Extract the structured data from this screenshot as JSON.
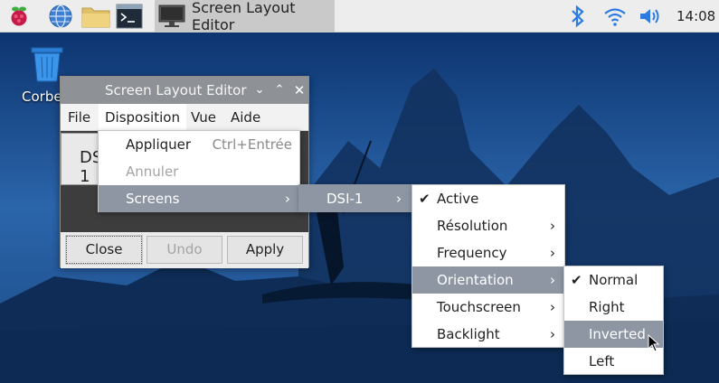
{
  "taskbar": {
    "icons": [
      "raspberry-menu-icon",
      "web-browser-icon",
      "file-manager-icon",
      "terminal-icon"
    ],
    "task_label": "Screen Layout Editor",
    "tray_icons": [
      "bluetooth-icon",
      "wifi-icon",
      "volume-icon"
    ],
    "clock": "14:08"
  },
  "desktop": {
    "trash_label": "Corbeille"
  },
  "window": {
    "title": "Screen Layout Editor",
    "menu": [
      "File",
      "Disposition",
      "Vue",
      "Aide"
    ],
    "screen_label": "DSI-1",
    "buttons": {
      "close": "Close",
      "undo": "Undo",
      "apply": "Apply"
    }
  },
  "menus": {
    "disposition": {
      "apply": "Appliquer",
      "apply_shortcut": "Ctrl+Entrée",
      "cancel": "Annuler",
      "screens": "Screens"
    },
    "screens": {
      "dsi": "DSI-1"
    },
    "dsi": {
      "items": [
        "Active",
        "Résolution",
        "Frequency",
        "Orientation",
        "Touchscreen",
        "Backlight"
      ]
    },
    "orientation": {
      "items": [
        "Normal",
        "Right",
        "Inverted",
        "Left"
      ]
    }
  },
  "colors": {
    "highlight": "#8d96a2",
    "taskbar": "#ededed",
    "titlebar": "#8e9196"
  }
}
